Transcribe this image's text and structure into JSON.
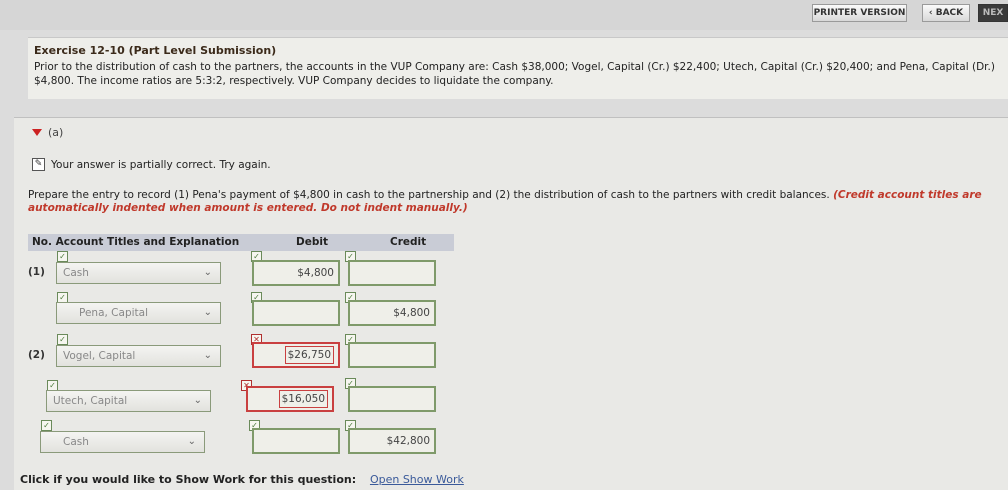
{
  "toolbar": {
    "printer_label": "PRINTER VERSION",
    "back_label": "‹ BACK",
    "next_label": "NEX"
  },
  "exercise": {
    "title": "Exercise 12-10 (Part Level Submission)",
    "text": "Prior to the distribution of cash to the partners, the accounts in the VUP Company are: Cash $38,000; Vogel, Capital (Cr.) $22,400; Utech, Capital (Cr.) $20,400; and Pena, Capital (Dr.) $4,800. The income ratios are 5:3:2, respectively. VUP Company decides to liquidate the company."
  },
  "part": {
    "label": "(a)",
    "status": "Your answer is partially correct.  Try again.",
    "instruction": "Prepare the entry to record (1) Pena's payment of $4,800 in cash to the partnership and (2) the distribution of cash to the partners with credit balances. ",
    "instruction_red": "(Credit account titles are automatically indented when amount is entered. Do not indent manually.)"
  },
  "table": {
    "headers": {
      "no_account": "No. Account Titles and Explanation",
      "debit": "Debit",
      "credit": "Credit"
    },
    "rows": [
      {
        "no": "(1)",
        "account": "Cash",
        "debit": "$4,800",
        "credit": "",
        "debit_wrong": false,
        "indent": false
      },
      {
        "no": "",
        "account": "Pena, Capital",
        "debit": "",
        "credit": "$4,800",
        "debit_wrong": false,
        "indent": true
      },
      {
        "no": "(2)",
        "account": "Vogel, Capital",
        "debit": "$26,750",
        "credit": "",
        "debit_wrong": true,
        "indent": false
      },
      {
        "no": "",
        "account": "Utech, Capital",
        "debit": "$16,050",
        "credit": "",
        "debit_wrong": true,
        "indent": false
      },
      {
        "no": "",
        "account": "Cash",
        "debit": "",
        "credit": "$42,800",
        "debit_wrong": false,
        "indent": true
      }
    ]
  },
  "footer": {
    "text": "Click if you would like to Show Work for this question:",
    "link": "Open Show Work"
  }
}
